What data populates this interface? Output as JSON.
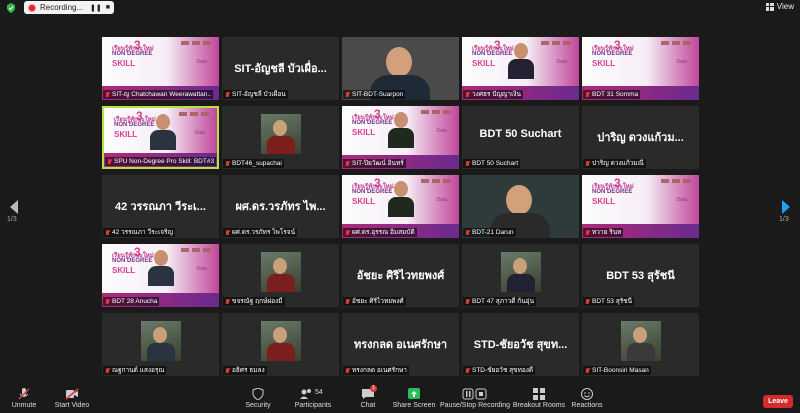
{
  "recording": {
    "label": "Recording..."
  },
  "view": {
    "label": "View"
  },
  "pages": {
    "left": "1/3",
    "right": "1/3"
  },
  "tiles": [
    {
      "name": "SIT-ญ Chatchawan Weerawattan..",
      "type": "slide"
    },
    {
      "name": "SIT-อัญชลี บัวเผื่อน",
      "display": "SIT-อัญชลี บัวเผื่อ...",
      "type": "name"
    },
    {
      "name": "SIT-BDT-Suarpon",
      "type": "cam"
    },
    {
      "name": "วงศธร ปัญญาเงิน",
      "type": "slidecam"
    },
    {
      "name": "BDT 31 Somma",
      "type": "slide"
    },
    {
      "name": "SPU Non-Degree Pro Skill: BDT#3",
      "type": "slidecam",
      "active": true
    },
    {
      "name": "BDT46_supachai",
      "type": "pic"
    },
    {
      "name": "SIT-ปิยวัฒน์ อินทร์",
      "type": "slidecam"
    },
    {
      "name": "BDT 50 Suchart",
      "display": "BDT 50 Suchart",
      "type": "name"
    },
    {
      "name": "ปาริญ ดวงแก้วมณี",
      "display": "ปาริญ ดวงแก้วม...",
      "type": "name"
    },
    {
      "name": "42 วรรณภา วีระเจริญ",
      "display": "42 วรรณภา วีระเ...",
      "type": "name"
    },
    {
      "name": "ผศ.ดร.วรภัทร ไพโรจน์",
      "display": "ผศ.ดร.วรภัทร ไพ...",
      "type": "name"
    },
    {
      "name": "ผศ.ดร.อุรรณ อิ่มสมบัติ",
      "type": "slidecam"
    },
    {
      "name": "BDT-21 Darun",
      "type": "cam2"
    },
    {
      "name": "ทวาย รินท",
      "type": "slide"
    },
    {
      "name": "BDT 28 Anucha",
      "type": "slidecam"
    },
    {
      "name": "ขจรณัฐ ฤกษ์ผ่องมี",
      "type": "pic"
    },
    {
      "name": "อัชยะ ศิริไวทยพงศ์",
      "display": "อัชยะ ศิริไวทยพงศ์",
      "type": "name"
    },
    {
      "name": "BDT 47 สุภาวดี ก้นอุ่น",
      "type": "pic"
    },
    {
      "name": "BDT 53 สุรัชนี",
      "display": "BDT 53 สุรัชนี",
      "type": "name"
    },
    {
      "name": "ณฐกานต์ แสงอรุณ",
      "type": "pic"
    },
    {
      "name": "อธิศร ธมลง",
      "type": "pic"
    },
    {
      "name": "ทรงกลด อเนศรักษา",
      "display": "ทรงกลด อเนศรักษา",
      "type": "name"
    },
    {
      "name": "STD-ชัยอวัช สุขทองดี",
      "display": "STD-ชัยอวัช สุขท...",
      "type": "name"
    },
    {
      "name": "SIT-Boonsiri Masan",
      "type": "pic"
    }
  ],
  "slide_text": {
    "t1": "เรียนรู้ทักษะใหม่",
    "t2": "NON DEGREE",
    "t3": "SKILL",
    "num": "3",
    "dtxt": "Data"
  },
  "toolbar": {
    "unmute": "Unmute",
    "start_video": "Start Video",
    "security": "Security",
    "participants": "Participants",
    "participants_count": "54",
    "chat": "Chat",
    "chat_badge": "1",
    "share": "Share Screen",
    "record": "Pause/Stop Recording",
    "breakout": "Breakout Rooms",
    "reactions": "Reactions",
    "leave": "Leave"
  },
  "colors": {
    "leave": "#d12d2d",
    "share": "#25c05a",
    "active_border": "#b6e23b",
    "accent": "#0e72ed"
  }
}
